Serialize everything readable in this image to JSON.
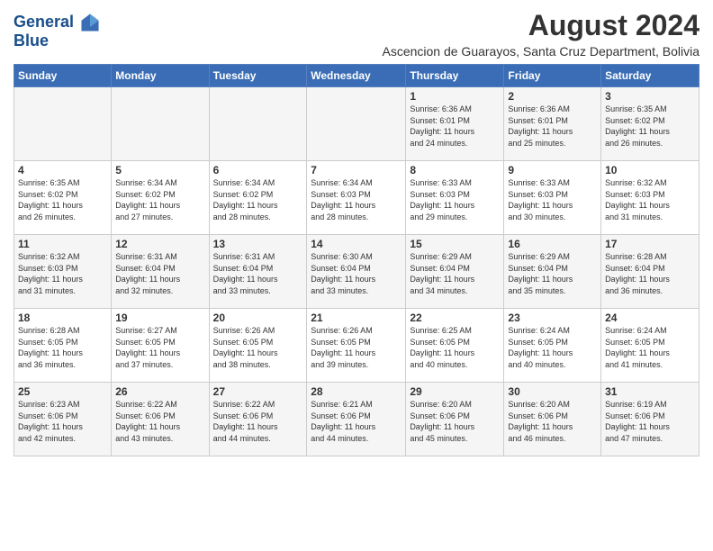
{
  "logo": {
    "line1": "General",
    "line2": "Blue"
  },
  "title": "August 2024",
  "subtitle": "Ascencion de Guarayos, Santa Cruz Department, Bolivia",
  "weekdays": [
    "Sunday",
    "Monday",
    "Tuesday",
    "Wednesday",
    "Thursday",
    "Friday",
    "Saturday"
  ],
  "weeks": [
    [
      {
        "day": "",
        "info": ""
      },
      {
        "day": "",
        "info": ""
      },
      {
        "day": "",
        "info": ""
      },
      {
        "day": "",
        "info": ""
      },
      {
        "day": "1",
        "info": "Sunrise: 6:36 AM\nSunset: 6:01 PM\nDaylight: 11 hours\nand 24 minutes."
      },
      {
        "day": "2",
        "info": "Sunrise: 6:36 AM\nSunset: 6:01 PM\nDaylight: 11 hours\nand 25 minutes."
      },
      {
        "day": "3",
        "info": "Sunrise: 6:35 AM\nSunset: 6:02 PM\nDaylight: 11 hours\nand 26 minutes."
      }
    ],
    [
      {
        "day": "4",
        "info": "Sunrise: 6:35 AM\nSunset: 6:02 PM\nDaylight: 11 hours\nand 26 minutes."
      },
      {
        "day": "5",
        "info": "Sunrise: 6:34 AM\nSunset: 6:02 PM\nDaylight: 11 hours\nand 27 minutes."
      },
      {
        "day": "6",
        "info": "Sunrise: 6:34 AM\nSunset: 6:02 PM\nDaylight: 11 hours\nand 28 minutes."
      },
      {
        "day": "7",
        "info": "Sunrise: 6:34 AM\nSunset: 6:03 PM\nDaylight: 11 hours\nand 28 minutes."
      },
      {
        "day": "8",
        "info": "Sunrise: 6:33 AM\nSunset: 6:03 PM\nDaylight: 11 hours\nand 29 minutes."
      },
      {
        "day": "9",
        "info": "Sunrise: 6:33 AM\nSunset: 6:03 PM\nDaylight: 11 hours\nand 30 minutes."
      },
      {
        "day": "10",
        "info": "Sunrise: 6:32 AM\nSunset: 6:03 PM\nDaylight: 11 hours\nand 31 minutes."
      }
    ],
    [
      {
        "day": "11",
        "info": "Sunrise: 6:32 AM\nSunset: 6:03 PM\nDaylight: 11 hours\nand 31 minutes."
      },
      {
        "day": "12",
        "info": "Sunrise: 6:31 AM\nSunset: 6:04 PM\nDaylight: 11 hours\nand 32 minutes."
      },
      {
        "day": "13",
        "info": "Sunrise: 6:31 AM\nSunset: 6:04 PM\nDaylight: 11 hours\nand 33 minutes."
      },
      {
        "day": "14",
        "info": "Sunrise: 6:30 AM\nSunset: 6:04 PM\nDaylight: 11 hours\nand 33 minutes."
      },
      {
        "day": "15",
        "info": "Sunrise: 6:29 AM\nSunset: 6:04 PM\nDaylight: 11 hours\nand 34 minutes."
      },
      {
        "day": "16",
        "info": "Sunrise: 6:29 AM\nSunset: 6:04 PM\nDaylight: 11 hours\nand 35 minutes."
      },
      {
        "day": "17",
        "info": "Sunrise: 6:28 AM\nSunset: 6:04 PM\nDaylight: 11 hours\nand 36 minutes."
      }
    ],
    [
      {
        "day": "18",
        "info": "Sunrise: 6:28 AM\nSunset: 6:05 PM\nDaylight: 11 hours\nand 36 minutes."
      },
      {
        "day": "19",
        "info": "Sunrise: 6:27 AM\nSunset: 6:05 PM\nDaylight: 11 hours\nand 37 minutes."
      },
      {
        "day": "20",
        "info": "Sunrise: 6:26 AM\nSunset: 6:05 PM\nDaylight: 11 hours\nand 38 minutes."
      },
      {
        "day": "21",
        "info": "Sunrise: 6:26 AM\nSunset: 6:05 PM\nDaylight: 11 hours\nand 39 minutes."
      },
      {
        "day": "22",
        "info": "Sunrise: 6:25 AM\nSunset: 6:05 PM\nDaylight: 11 hours\nand 40 minutes."
      },
      {
        "day": "23",
        "info": "Sunrise: 6:24 AM\nSunset: 6:05 PM\nDaylight: 11 hours\nand 40 minutes."
      },
      {
        "day": "24",
        "info": "Sunrise: 6:24 AM\nSunset: 6:05 PM\nDaylight: 11 hours\nand 41 minutes."
      }
    ],
    [
      {
        "day": "25",
        "info": "Sunrise: 6:23 AM\nSunset: 6:06 PM\nDaylight: 11 hours\nand 42 minutes."
      },
      {
        "day": "26",
        "info": "Sunrise: 6:22 AM\nSunset: 6:06 PM\nDaylight: 11 hours\nand 43 minutes."
      },
      {
        "day": "27",
        "info": "Sunrise: 6:22 AM\nSunset: 6:06 PM\nDaylight: 11 hours\nand 44 minutes."
      },
      {
        "day": "28",
        "info": "Sunrise: 6:21 AM\nSunset: 6:06 PM\nDaylight: 11 hours\nand 44 minutes."
      },
      {
        "day": "29",
        "info": "Sunrise: 6:20 AM\nSunset: 6:06 PM\nDaylight: 11 hours\nand 45 minutes."
      },
      {
        "day": "30",
        "info": "Sunrise: 6:20 AM\nSunset: 6:06 PM\nDaylight: 11 hours\nand 46 minutes."
      },
      {
        "day": "31",
        "info": "Sunrise: 6:19 AM\nSunset: 6:06 PM\nDaylight: 11 hours\nand 47 minutes."
      }
    ]
  ]
}
